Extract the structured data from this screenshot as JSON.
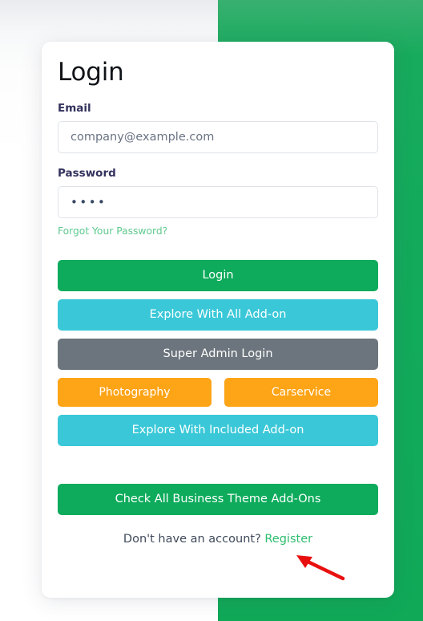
{
  "page": {
    "title": "Login"
  },
  "form": {
    "email": {
      "label": "Email",
      "value": "",
      "placeholder": "company@example.com"
    },
    "password": {
      "label": "Password",
      "masked_value": "••••"
    },
    "forgot_password_link": "Forgot Your Password?"
  },
  "buttons": {
    "login": "Login",
    "explore_all_addon": "Explore With All Add-on",
    "super_admin_login": "Super Admin Login",
    "photography": "Photography",
    "carservice": "Carservice",
    "explore_included_addon": "Explore With Included Add-on",
    "check_all_business_theme": "Check All Business Theme Add-Ons"
  },
  "footer": {
    "prompt": "Don't have an account?",
    "register_link": "Register"
  },
  "colors": {
    "brand_green": "#0dab5b",
    "panel_green": "#12aa5b",
    "cyan": "#3ac8d8",
    "gray": "#6c757d",
    "orange": "#fda417",
    "link_green": "#5fc98f",
    "register_green": "#2ebd6f",
    "annotation_red": "#e8100f",
    "label_text": "#32325d"
  }
}
